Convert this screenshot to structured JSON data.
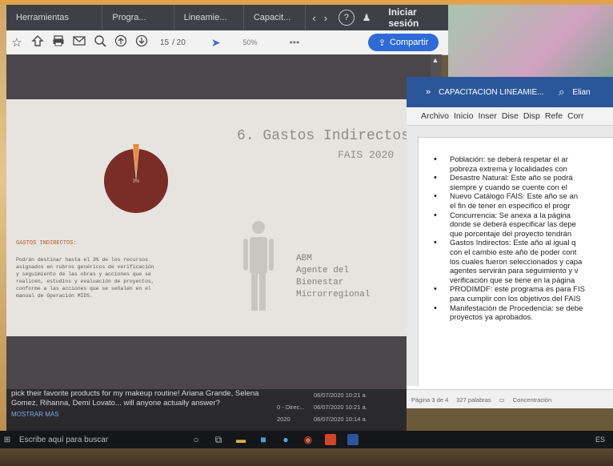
{
  "browser": {
    "tabs": [
      "Herramientas",
      "Progra...",
      "Lineamie...",
      "Capacit..."
    ],
    "nav_prev": "‹",
    "nav_next": "›",
    "help_glyph": "?",
    "user_glyph": "♟",
    "signin_label": "Iniciar sesión",
    "toolbar_icons": [
      "star-icon",
      "add-collection-icon",
      "print-icon",
      "email-icon",
      "zoom-icon",
      "page-up-icon",
      "page-down-icon"
    ],
    "page_current": "15",
    "page_total": "/ 20",
    "zoom_level": "50%",
    "more_glyph": "•••",
    "share_label": "Compartir"
  },
  "slide": {
    "title": "6. Gastos Indirectos",
    "subtitle": "FAIS 2020",
    "pie_label": "3%",
    "section_label": "GASTOS INDIRECTOS:",
    "body": [
      "Podrán destinar hasta el 3% de los recursos",
      "asignados en rubros genéricos de verificación",
      "y seguimiento de las obras y acciones que se",
      "realicen, estudios y evaluación de proyectos,",
      "conforme a las acciones que se señalen en el",
      "manual de Operación MIDS."
    ],
    "agent_lines": [
      "ABM",
      "Agente del",
      "Bienestar",
      "Microrregional"
    ]
  },
  "chart_data": {
    "type": "pie",
    "values": [
      97,
      3
    ],
    "data_labels": [
      "",
      "3%"
    ],
    "colors": [
      "#7a2c27",
      "#e88a3a"
    ]
  },
  "word": {
    "title": "CAPACITACIÓN LINEAMIE...",
    "user": "Elian",
    "ribbon": [
      "Archivo",
      "Inicio",
      "Inser",
      "Dise",
      "Disp",
      "Refe",
      "Corr"
    ],
    "bullets": [
      {
        "l1": "Población: se deberá respetar el ar",
        "l2": "pobreza extrema y localidades con"
      },
      {
        "l1": "Desastre Natural: Este año se podrá",
        "l2": "siempre y cuando se cuente con el"
      },
      {
        "l1": "Nuevo Catálogo FAIS: Este año se an",
        "l2": "el fin de tener en especifico el progr"
      },
      {
        "l1": "Concurrencia: Se anexa a la página",
        "l2": "donde se deberá especificar las depe",
        "l3": "que porcentaje del proyecto tendrán"
      },
      {
        "l1": "Gastos Indirectos: Este año al igual q",
        "l2": "con el cambio este año de poder cont",
        "l3": "los cuales fueron seleccionados y capa",
        "l4": "agentes servirán para seguimiento y v",
        "l5": "verificación que se tiene en la página"
      },
      {
        "l1": "PRODIMDF: este programa es para FIS",
        "l2": "para cumplir con los objetivos del FAIS"
      },
      {
        "l1": "Manifestación de Procedencia: se debe",
        "l2": "proyectos ya aprobados."
      }
    ],
    "status_page": "Página 3 de 4",
    "status_words": "327 palabras",
    "status_focus": "Concentración"
  },
  "news": {
    "text": "pick their favorite products for my makeup routine! Ariana Grande, Selena Gomez, Rihanna, Demi Lovato... will anyone actually answer?",
    "more_label": "MOSTRAR MÁS"
  },
  "files": [
    {
      "name": "",
      "date": "06/07/2020 10:21 a."
    },
    {
      "name": "0 - Direc...",
      "date": "06/07/2020 10:21 a."
    },
    {
      "name": "2020",
      "date": "06/07/2020 10:14 a."
    }
  ],
  "taskbar": {
    "search_placeholder": "Escribe aquí para buscar",
    "tray_text": "ES"
  }
}
